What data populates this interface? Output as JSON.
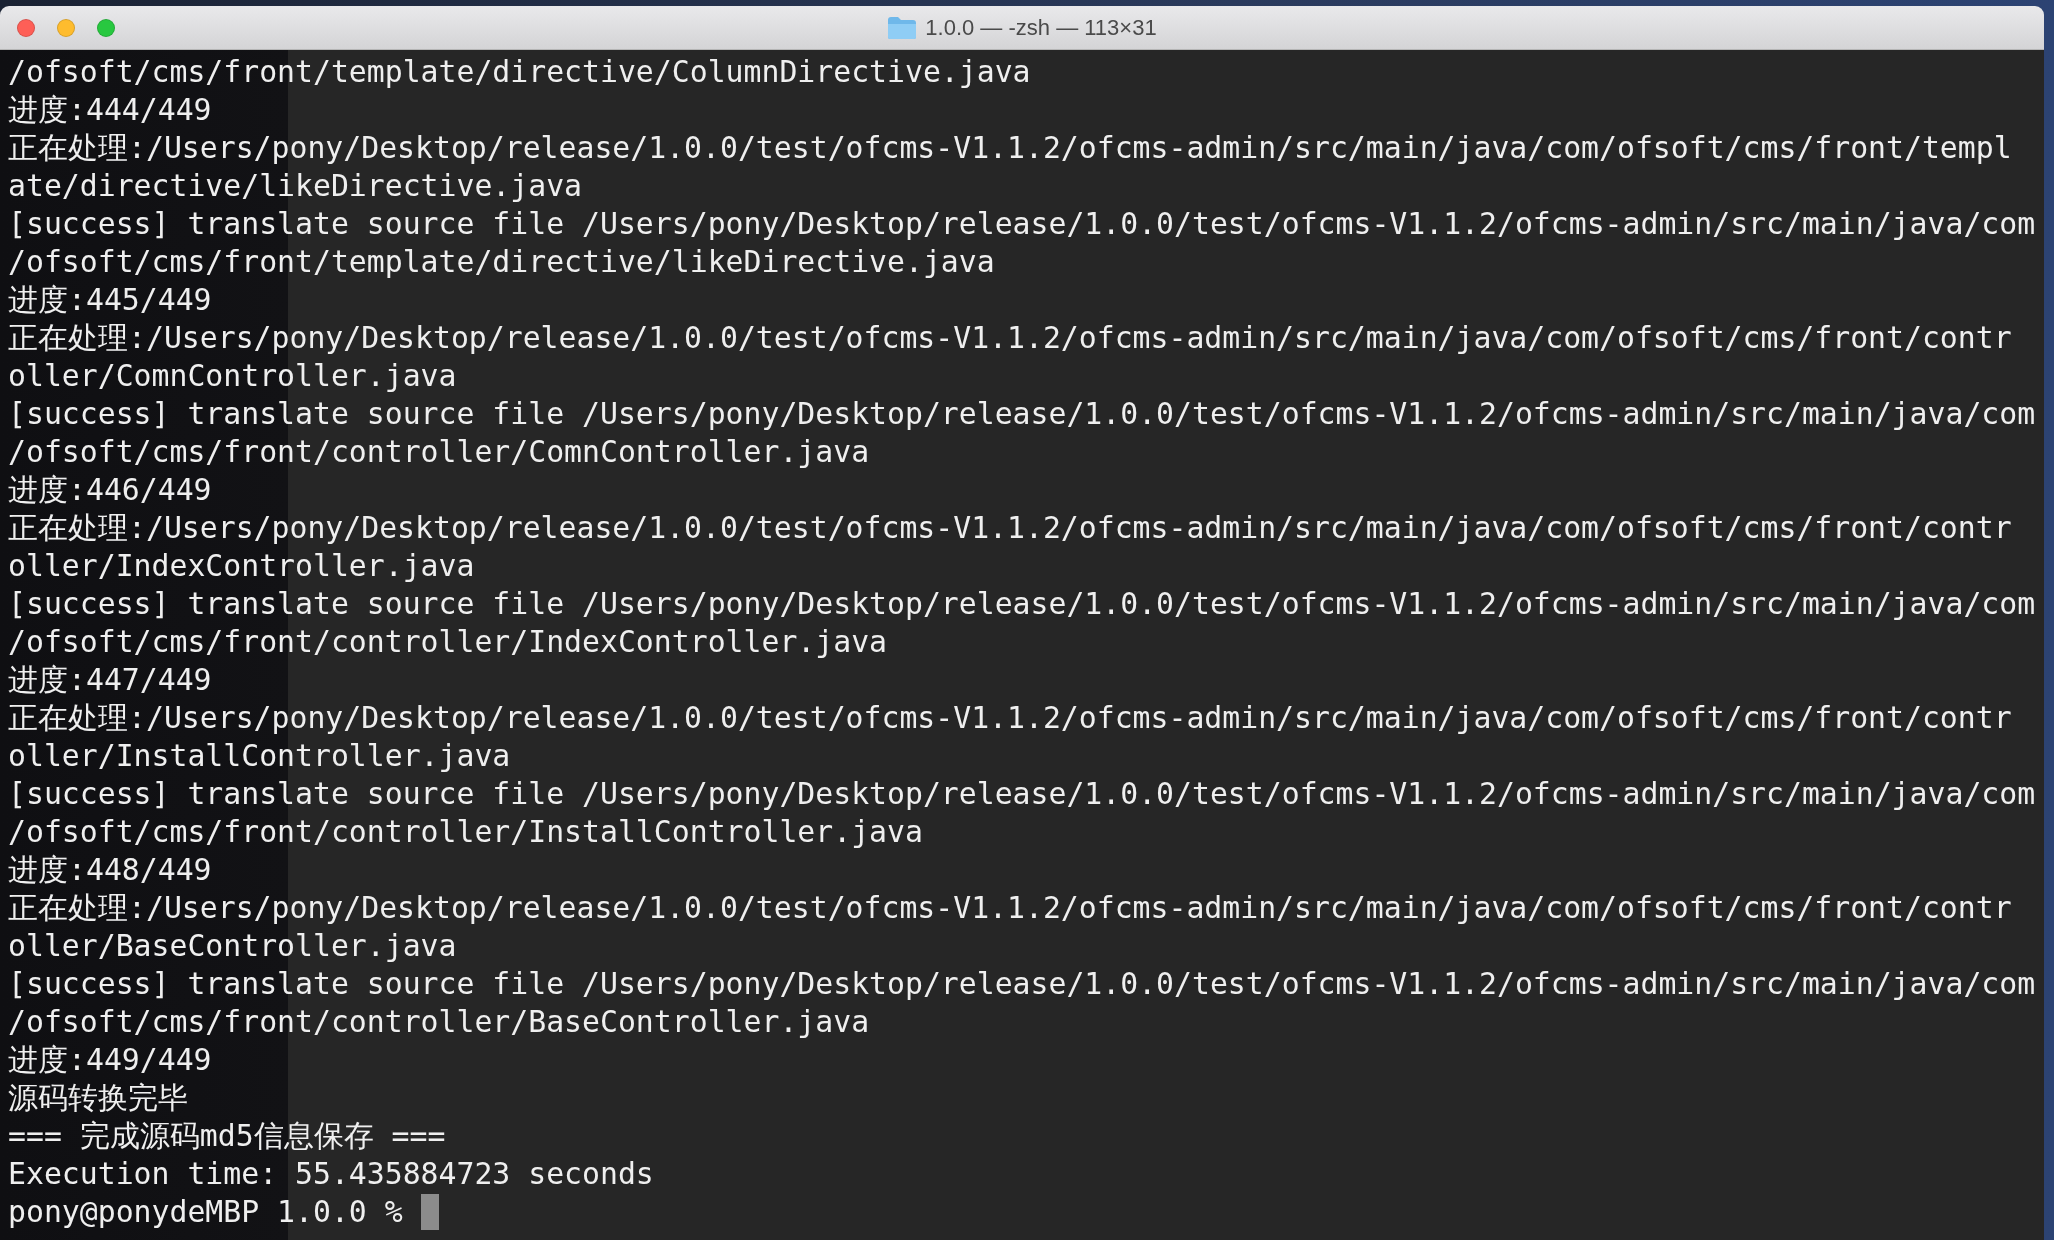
{
  "window": {
    "title": "1.0.0 — -zsh — 113×31"
  },
  "terminal": {
    "lines": [
      "/ofsoft/cms/front/template/directive/ColumnDirective.java",
      "进度:444/449",
      "正在处理:/Users/pony/Desktop/release/1.0.0/test/ofcms-V1.1.2/ofcms-admin/src/main/java/com/ofsoft/cms/front/templ",
      "ate/directive/likeDirective.java",
      "[success] translate source file /Users/pony/Desktop/release/1.0.0/test/ofcms-V1.1.2/ofcms-admin/src/main/java/com",
      "/ofsoft/cms/front/template/directive/likeDirective.java",
      "进度:445/449",
      "正在处理:/Users/pony/Desktop/release/1.0.0/test/ofcms-V1.1.2/ofcms-admin/src/main/java/com/ofsoft/cms/front/contr",
      "oller/ComnController.java",
      "[success] translate source file /Users/pony/Desktop/release/1.0.0/test/ofcms-V1.1.2/ofcms-admin/src/main/java/com",
      "/ofsoft/cms/front/controller/ComnController.java",
      "进度:446/449",
      "正在处理:/Users/pony/Desktop/release/1.0.0/test/ofcms-V1.1.2/ofcms-admin/src/main/java/com/ofsoft/cms/front/contr",
      "oller/IndexController.java",
      "[success] translate source file /Users/pony/Desktop/release/1.0.0/test/ofcms-V1.1.2/ofcms-admin/src/main/java/com",
      "/ofsoft/cms/front/controller/IndexController.java",
      "进度:447/449",
      "正在处理:/Users/pony/Desktop/release/1.0.0/test/ofcms-V1.1.2/ofcms-admin/src/main/java/com/ofsoft/cms/front/contr",
      "oller/InstallController.java",
      "[success] translate source file /Users/pony/Desktop/release/1.0.0/test/ofcms-V1.1.2/ofcms-admin/src/main/java/com",
      "/ofsoft/cms/front/controller/InstallController.java",
      "进度:448/449",
      "正在处理:/Users/pony/Desktop/release/1.0.0/test/ofcms-V1.1.2/ofcms-admin/src/main/java/com/ofsoft/cms/front/contr",
      "oller/BaseController.java",
      "[success] translate source file /Users/pony/Desktop/release/1.0.0/test/ofcms-V1.1.2/ofcms-admin/src/main/java/com",
      "/ofsoft/cms/front/controller/BaseController.java",
      "进度:449/449",
      "源码转换完毕",
      "=== 完成源码md5信息保存 ===",
      "Execution time: 55.435884723 seconds"
    ],
    "prompt": "pony@ponydeMBP 1.0.0 %"
  }
}
